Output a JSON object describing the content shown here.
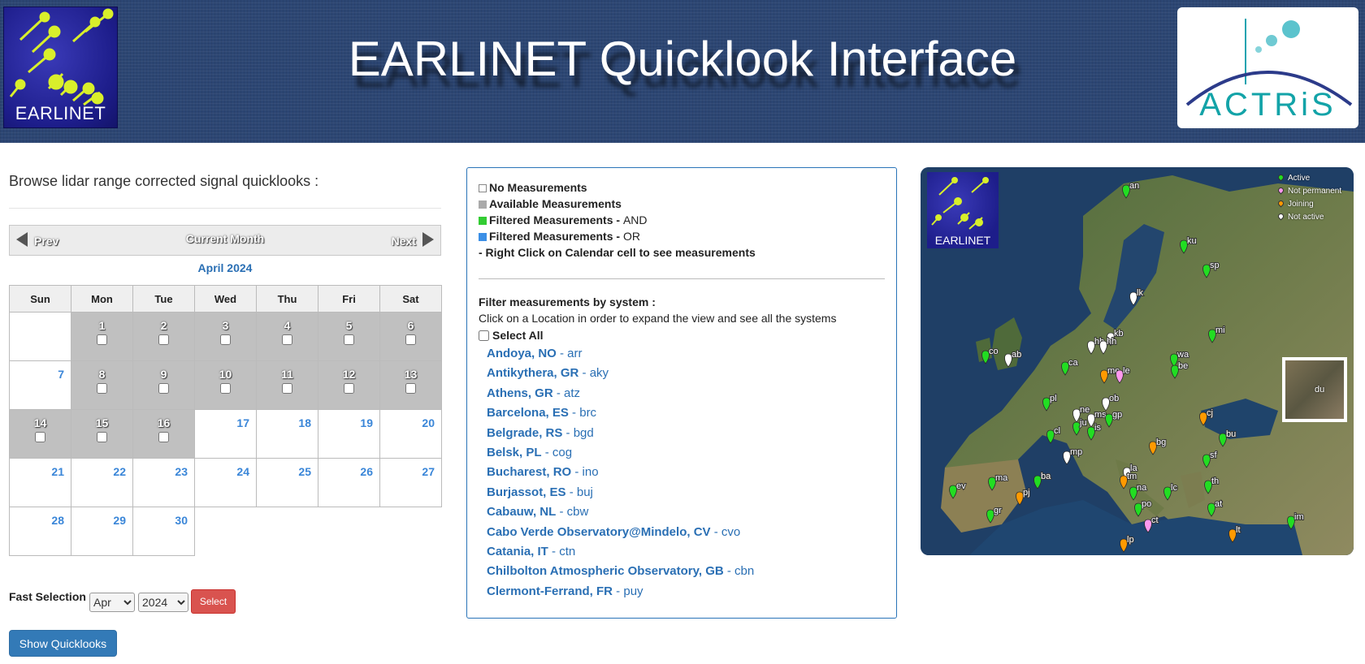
{
  "header": {
    "title": "EARLINET Quicklook Interface",
    "left_logo_text": "EARLINET",
    "right_logo_text": "ACTRiS"
  },
  "browse_label": "Browse lidar range corrected signal quicklooks :",
  "calendar": {
    "prev_label": "Prev",
    "current_label": "Current Month",
    "next_label": "Next",
    "month_title": "April 2024",
    "weekdays": [
      "Sun",
      "Mon",
      "Tue",
      "Wed",
      "Thu",
      "Fri",
      "Sat"
    ],
    "available_days": [
      1,
      2,
      3,
      4,
      5,
      6,
      8,
      9,
      10,
      11,
      12,
      13,
      14,
      15,
      16
    ],
    "days": [
      "1",
      "2",
      "3",
      "4",
      "5",
      "6",
      "7",
      "8",
      "9",
      "10",
      "11",
      "12",
      "13",
      "14",
      "15",
      "16",
      "17",
      "18",
      "19",
      "20",
      "21",
      "22",
      "23",
      "24",
      "25",
      "26",
      "27",
      "28",
      "29",
      "30"
    ]
  },
  "fast_selection": {
    "label": "Fast Selection",
    "month_value": "Apr",
    "year_value": "2024",
    "select_label": "Select"
  },
  "show_quicklooks_label": "Show Quicklooks",
  "legend": {
    "no_measurements": "No Measurements",
    "available": "Available Measurements",
    "filtered_and": "Filtered Measurements - ",
    "filtered_and_suffix": "AND",
    "filtered_or": "Filtered Measurements - ",
    "filtered_or_suffix": "OR",
    "right_click_note": "- Right Click on Calendar cell to see measurements",
    "colors": {
      "no": "#ffffff",
      "available": "#aaaaaa",
      "and": "#33cc33",
      "or": "#3b8fe6"
    }
  },
  "filter": {
    "title": "Filter measurements by system :",
    "subtitle": "Click on a Location in order to expand the view and see all the systems",
    "select_all": "Select All",
    "locations": [
      {
        "name": "Andoya, NO",
        "code": " - arr"
      },
      {
        "name": "Antikythera, GR",
        "code": " - aky"
      },
      {
        "name": "Athens, GR",
        "code": " - atz"
      },
      {
        "name": "Barcelona, ES",
        "code": " - brc"
      },
      {
        "name": "Belgrade, RS",
        "code": " - bgd"
      },
      {
        "name": "Belsk, PL",
        "code": " - cog"
      },
      {
        "name": "Bucharest, RO",
        "code": " - ino"
      },
      {
        "name": "Burjassot, ES",
        "code": " - buj"
      },
      {
        "name": "Cabauw, NL",
        "code": " - cbw"
      },
      {
        "name": "Cabo Verde Observatory@Mindelo, CV",
        "code": " - cvo"
      },
      {
        "name": "Catania, IT",
        "code": " - ctn"
      },
      {
        "name": "Chilbolton Atmospheric Observatory, GB",
        "code": " - cbn"
      },
      {
        "name": "Clermont-Ferrand, FR",
        "code": " - puy"
      }
    ]
  },
  "map": {
    "logo_text": "EARLINET",
    "legend": [
      {
        "label": "Active",
        "color": "#22dd22"
      },
      {
        "label": "Not permanent",
        "color": "#ff99ee"
      },
      {
        "label": "Joining",
        "color": "#ff9a00"
      },
      {
        "label": "Not active",
        "color": "#ffffff"
      }
    ],
    "inset_code": "du",
    "station_codes": [
      "an",
      "ku",
      "sp",
      "lk",
      "kb",
      "hb",
      "hh",
      "mi",
      "co",
      "ab",
      "ca",
      "wa",
      "me",
      "le",
      "be",
      "pl",
      "ob",
      "ne",
      "ms",
      "gp",
      "cj",
      "ju",
      "is",
      "bu",
      "cl",
      "bg",
      "sf",
      "mp",
      "la",
      "ev",
      "ma",
      "ba",
      "tm",
      "na",
      "lc",
      "th",
      "gr",
      "pj",
      "po",
      "at",
      "ct",
      "im",
      "lp",
      "lt"
    ]
  }
}
